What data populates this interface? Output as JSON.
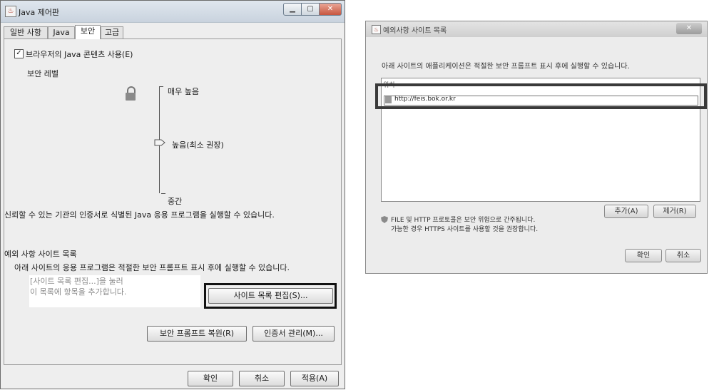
{
  "left_window": {
    "title": "Java 제어판",
    "tabs": [
      "일반 사항",
      "Java",
      "보안",
      "고급"
    ],
    "active_tab_index": 2,
    "browser_checkbox": {
      "label": "브라우저의 Java 콘텐츠 사용(E)",
      "checked": true
    },
    "security_level_heading": "보안 레벨",
    "levels": {
      "very_high": "매우 높음",
      "high": "높음(최소 권장)",
      "medium": "중간"
    },
    "level_description": "신뢰할 수 있는 기관의 인증서로 식별된 Java 응용 프로그램을 실행할 수 있습니다.",
    "exception_heading": "예외 사항 사이트 목록",
    "exception_description": "아래 사이트의 응용 프로그램은 적절한 보안 프롬프트 표시 후에 실행할 수 있습니다.",
    "exception_placeholder_line1": "[사이트 목록 편집...]을 눌러",
    "exception_placeholder_line2": "이 목록에 항목을 추가합니다.",
    "edit_site_list_button": "사이트 목록 편집(S)...",
    "restore_prompts_button": "보안 프롬프트 복원(R)",
    "manage_certificates_button": "인증서 관리(M)...",
    "ok_button": "확인",
    "cancel_button": "취소",
    "apply_button": "적용(A)"
  },
  "right_window": {
    "title": "예외사항 사이트 목록",
    "description": "아래 사이트의 애플리케이션은 적절한 보안 프롬프트 표시 후에 실행할 수 있습니다.",
    "column_header": "위치",
    "site_url": "http://feis.bok.or.kr",
    "add_button": "추가(A)",
    "remove_button": "제거(R)",
    "warning_line1": "FILE 및 HTTP 프로토콜은 보안 위험으로 간주됩니다.",
    "warning_line2": "가능한 경우 HTTPS 사이트를 사용할 것을 권장합니다.",
    "ok_button": "확인",
    "cancel_button": "취소"
  }
}
